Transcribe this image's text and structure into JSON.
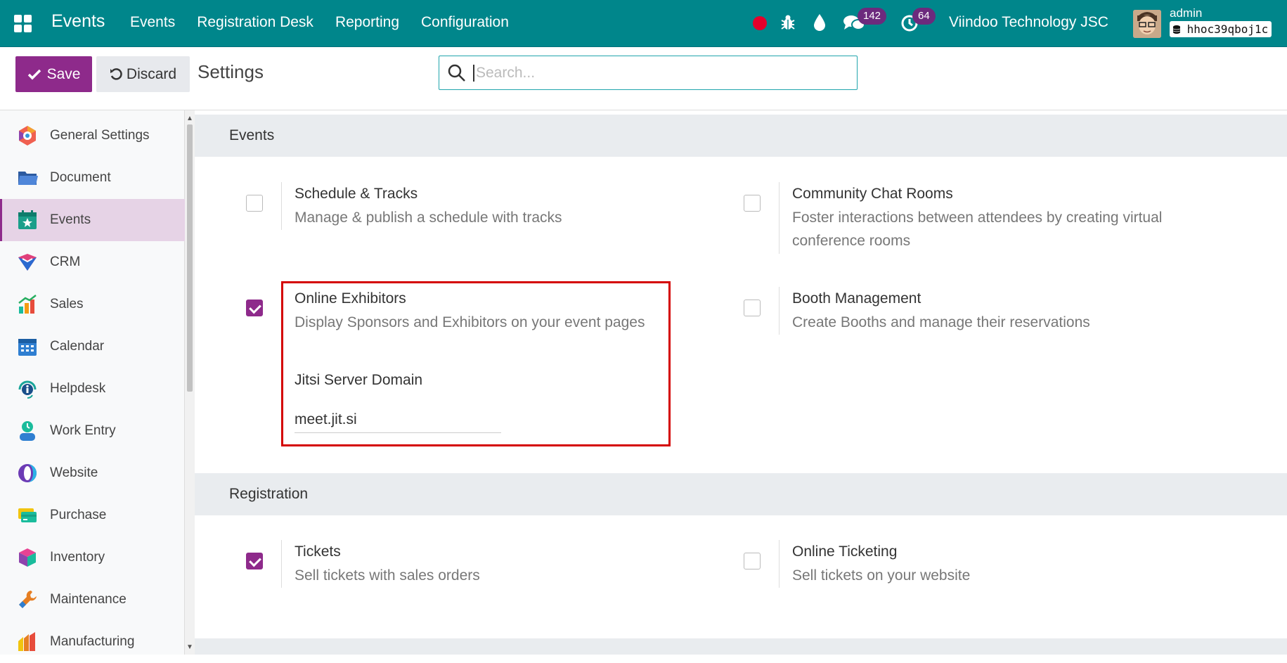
{
  "navbar": {
    "brand": "Events",
    "menu": [
      "Events",
      "Registration Desk",
      "Reporting",
      "Configuration"
    ],
    "messages_badge": "142",
    "activities_badge": "64",
    "company": "Viindoo Technology JSC",
    "username": "admin",
    "database": "hhoc39qboj1c",
    "bg_color": "#00868b"
  },
  "control": {
    "save_label": "Save",
    "discard_label": "Discard",
    "title": "Settings",
    "search_placeholder": "Search..."
  },
  "sidebar": {
    "items": [
      {
        "label": "General Settings",
        "icon": "general-settings-icon"
      },
      {
        "label": "Document",
        "icon": "folder-icon"
      },
      {
        "label": "Events",
        "icon": "calendar-star-icon",
        "active": true
      },
      {
        "label": "CRM",
        "icon": "crm-icon"
      },
      {
        "label": "Sales",
        "icon": "sales-chart-icon"
      },
      {
        "label": "Calendar",
        "icon": "calendar-icon"
      },
      {
        "label": "Helpdesk",
        "icon": "helpdesk-icon"
      },
      {
        "label": "Work Entry",
        "icon": "work-entry-icon"
      },
      {
        "label": "Website",
        "icon": "website-icon"
      },
      {
        "label": "Purchase",
        "icon": "credit-card-icon"
      },
      {
        "label": "Inventory",
        "icon": "box-icon"
      },
      {
        "label": "Maintenance",
        "icon": "wrench-icon"
      },
      {
        "label": "Manufacturing",
        "icon": "manufacturing-icon"
      }
    ]
  },
  "sections": {
    "events": {
      "title": "Events",
      "schedule": {
        "title": "Schedule & Tracks",
        "desc": "Manage & publish a schedule with tracks",
        "checked": false
      },
      "chat": {
        "title": "Community Chat Rooms",
        "desc": "Foster interactions between attendees by creating virtual conference rooms",
        "checked": false
      },
      "exhibitors": {
        "title": "Online Exhibitors",
        "desc": "Display Sponsors and Exhibitors on your event pages",
        "checked": true,
        "field_label": "Jitsi Server Domain",
        "field_value": "meet.jit.si"
      },
      "booth": {
        "title": "Booth Management",
        "desc": "Create Booths and manage their reservations",
        "checked": false
      }
    },
    "registration": {
      "title": "Registration",
      "tickets": {
        "title": "Tickets",
        "desc": "Sell tickets with sales orders",
        "checked": true
      },
      "online_ticketing": {
        "title": "Online Ticketing",
        "desc": "Sell tickets on your website",
        "checked": false
      }
    }
  }
}
